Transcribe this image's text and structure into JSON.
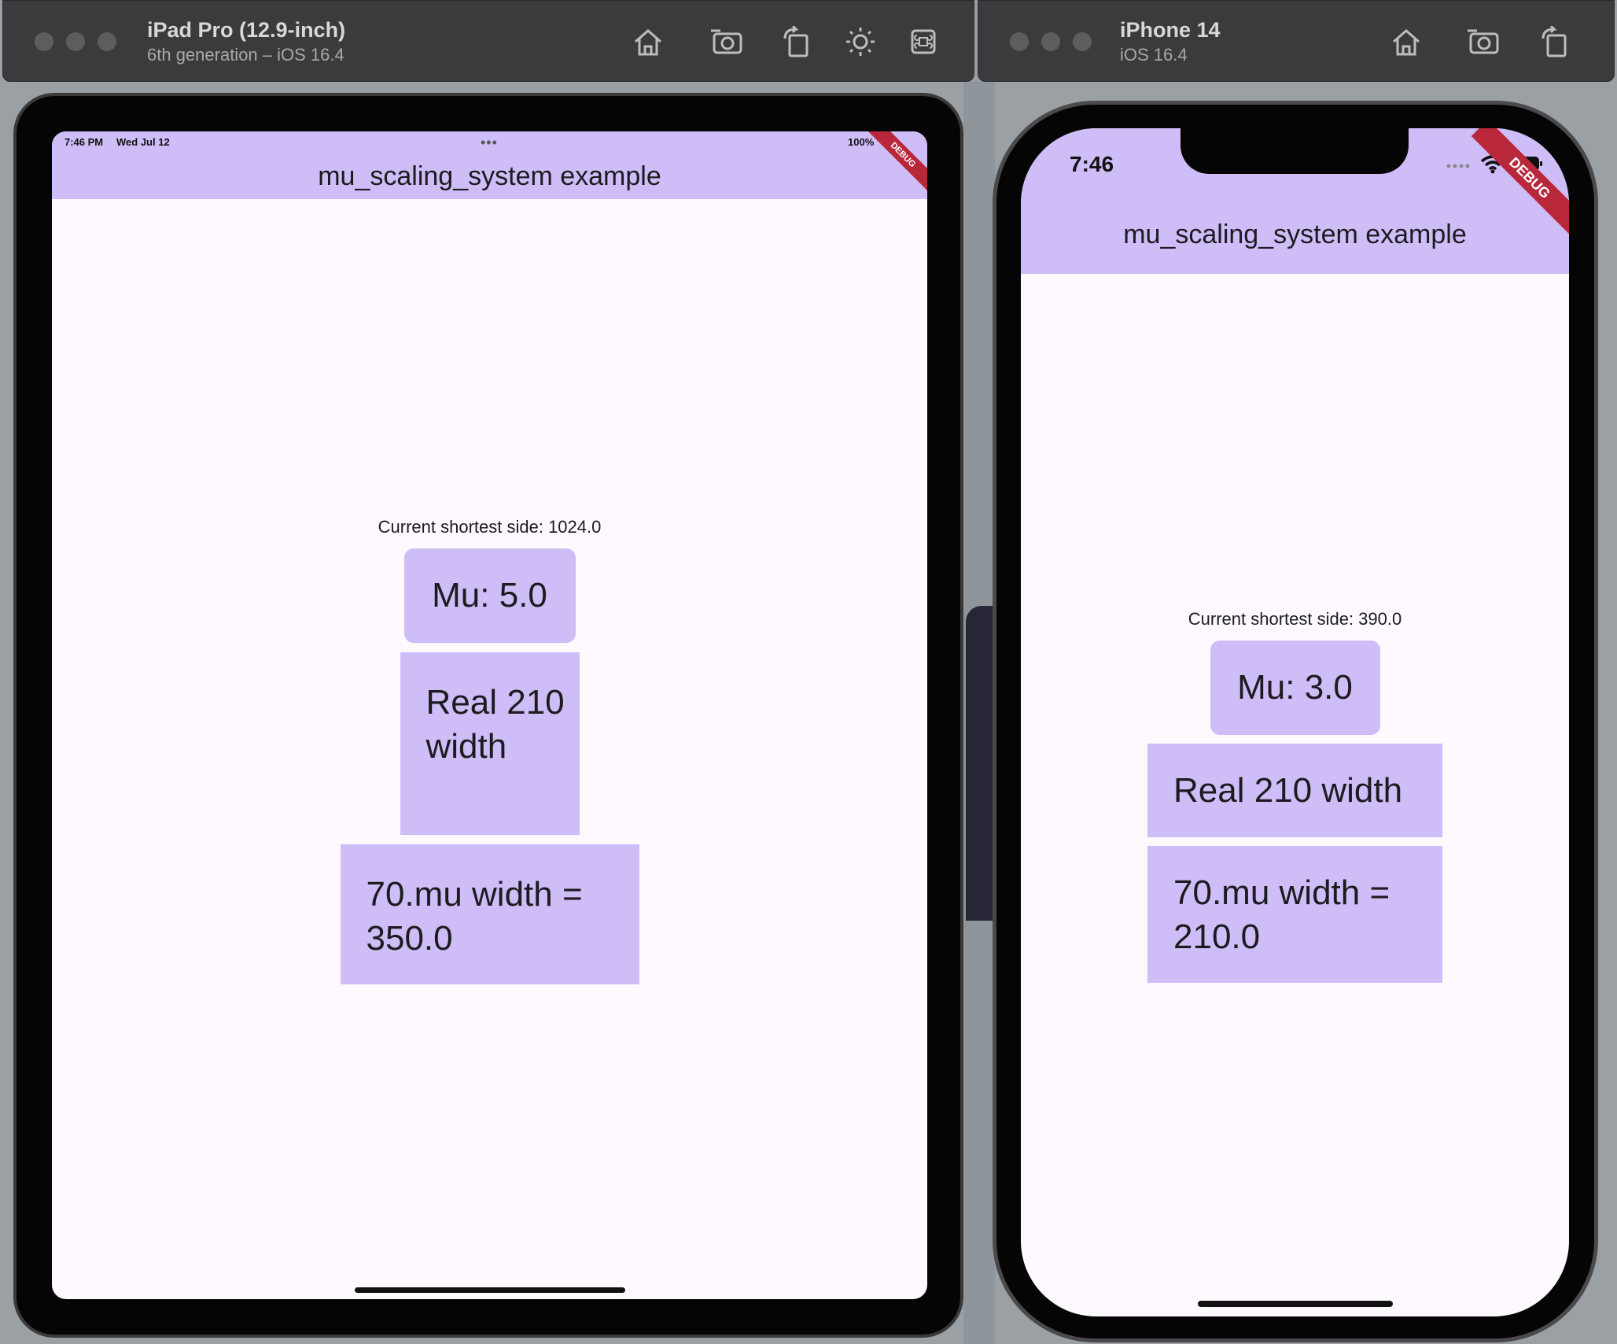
{
  "ipad_window": {
    "device_name": "iPad Pro (12.9-inch)",
    "device_sub": "6th generation – iOS 16.4",
    "toolbar_icons": [
      "home-icon",
      "screenshot-icon",
      "rotate-icon",
      "appearance-icon",
      "command-icon"
    ]
  },
  "iphone_window": {
    "device_name": "iPhone 14",
    "device_sub": "iOS 16.4",
    "toolbar_icons": [
      "home-icon",
      "screenshot-icon",
      "rotate-icon"
    ]
  },
  "ipad_app": {
    "status_time": "7:46 PM",
    "status_date": "Wed Jul 12",
    "status_battery": "100%",
    "multitask_dots": "•••",
    "app_title": "mu_scaling_system example",
    "debug_label": "DEBUG",
    "shortest_side": "Current shortest side: 1024.0",
    "mu_label": "Mu: 5.0",
    "real_label": "Real 210 width",
    "mu70_label": "70.mu width = 350.0"
  },
  "iphone_app": {
    "status_time": "7:46",
    "app_title": "mu_scaling_system example",
    "debug_label": "DEBUG",
    "shortest_side": "Current shortest side: 390.0",
    "mu_label": "Mu: 3.0",
    "real_label": "Real 210 width",
    "mu70_label": "70.mu width = 210.0"
  },
  "colors": {
    "app_bar": "#cfbdf8",
    "box": "#cfbdf8",
    "screen_bg": "#fef9fe",
    "debug_ribbon": "#b8273a",
    "title_bar": "#3b3b3d"
  }
}
